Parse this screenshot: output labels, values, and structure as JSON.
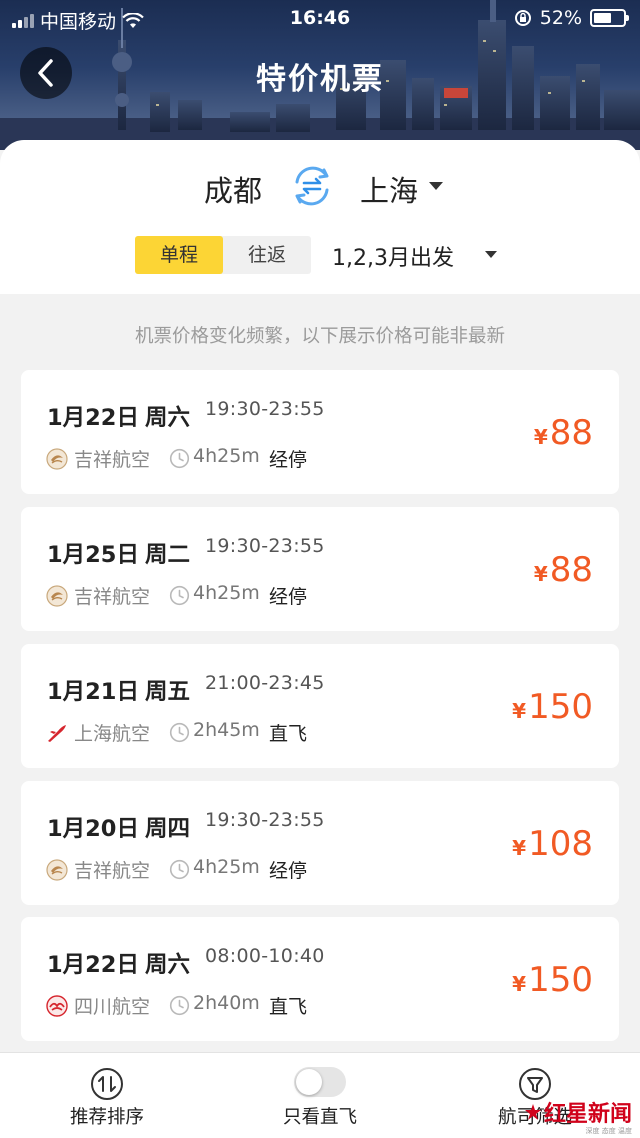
{
  "status_bar": {
    "carrier": "中国移动",
    "time": "16:46",
    "battery": "52%"
  },
  "header": {
    "title": "特价机票"
  },
  "route": {
    "from": "成都",
    "to": "上海"
  },
  "trip_type": {
    "options": [
      "单程",
      "往返"
    ],
    "selected": "单程"
  },
  "departure": {
    "label": "1,2,3月出发"
  },
  "notice": "机票价格变化频繁，以下展示价格可能非最新",
  "flights": [
    {
      "date": "1月22日",
      "weekday": "周六",
      "time": "19:30-23:55",
      "airline": "吉祥航空",
      "airline_icon": "juneyao-logo-icon",
      "duration": "4h25m",
      "stop": "经停",
      "currency": "¥",
      "price": "88"
    },
    {
      "date": "1月25日",
      "weekday": "周二",
      "time": "19:30-23:55",
      "airline": "吉祥航空",
      "airline_icon": "juneyao-logo-icon",
      "duration": "4h25m",
      "stop": "经停",
      "currency": "¥",
      "price": "88"
    },
    {
      "date": "1月21日",
      "weekday": "周五",
      "time": "21:00-23:45",
      "airline": "上海航空",
      "airline_icon": "shanghai-airlines-logo-icon",
      "duration": "2h45m",
      "stop": "直飞",
      "currency": "¥",
      "price": "150"
    },
    {
      "date": "1月20日",
      "weekday": "周四",
      "time": "19:30-23:55",
      "airline": "吉祥航空",
      "airline_icon": "juneyao-logo-icon",
      "duration": "4h25m",
      "stop": "经停",
      "currency": "¥",
      "price": "108"
    },
    {
      "date": "1月22日",
      "weekday": "周六",
      "time": "08:00-10:40",
      "airline": "四川航空",
      "airline_icon": "sichuan-airlines-logo-icon",
      "duration": "2h40m",
      "stop": "直飞",
      "currency": "¥",
      "price": "150"
    }
  ],
  "bottom_bar": {
    "sort_label": "推荐排序",
    "direct_label": "只看直飞",
    "filter_label": "航司筛选"
  },
  "watermark": {
    "text": "红星新闻",
    "sub": "深度 态度 温度"
  },
  "colors": {
    "accent_yellow": "#fcd535",
    "price_orange": "#f15a24",
    "swap_blue": "#2f8fe8"
  }
}
